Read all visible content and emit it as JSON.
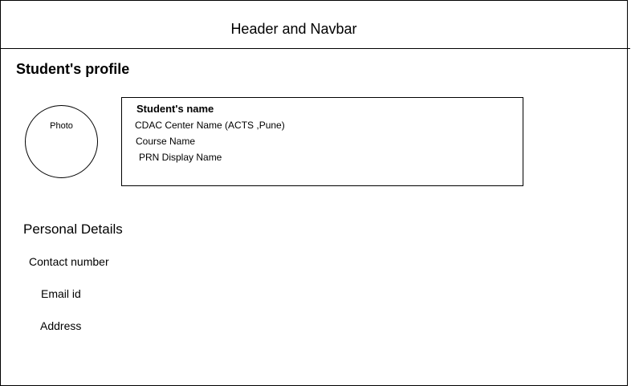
{
  "header": {
    "title": "Header and Navbar"
  },
  "page": {
    "title": "Student's profile"
  },
  "photo": {
    "label": "Photo"
  },
  "student_card": {
    "name": "Student's name",
    "center": "CDAC Center Name (ACTS ,Pune)",
    "course": "Course Name",
    "prn": "PRN  Display Name"
  },
  "personal_details": {
    "title": "Personal Details",
    "contact": "Contact number",
    "email": "Email id",
    "address": "Address"
  }
}
